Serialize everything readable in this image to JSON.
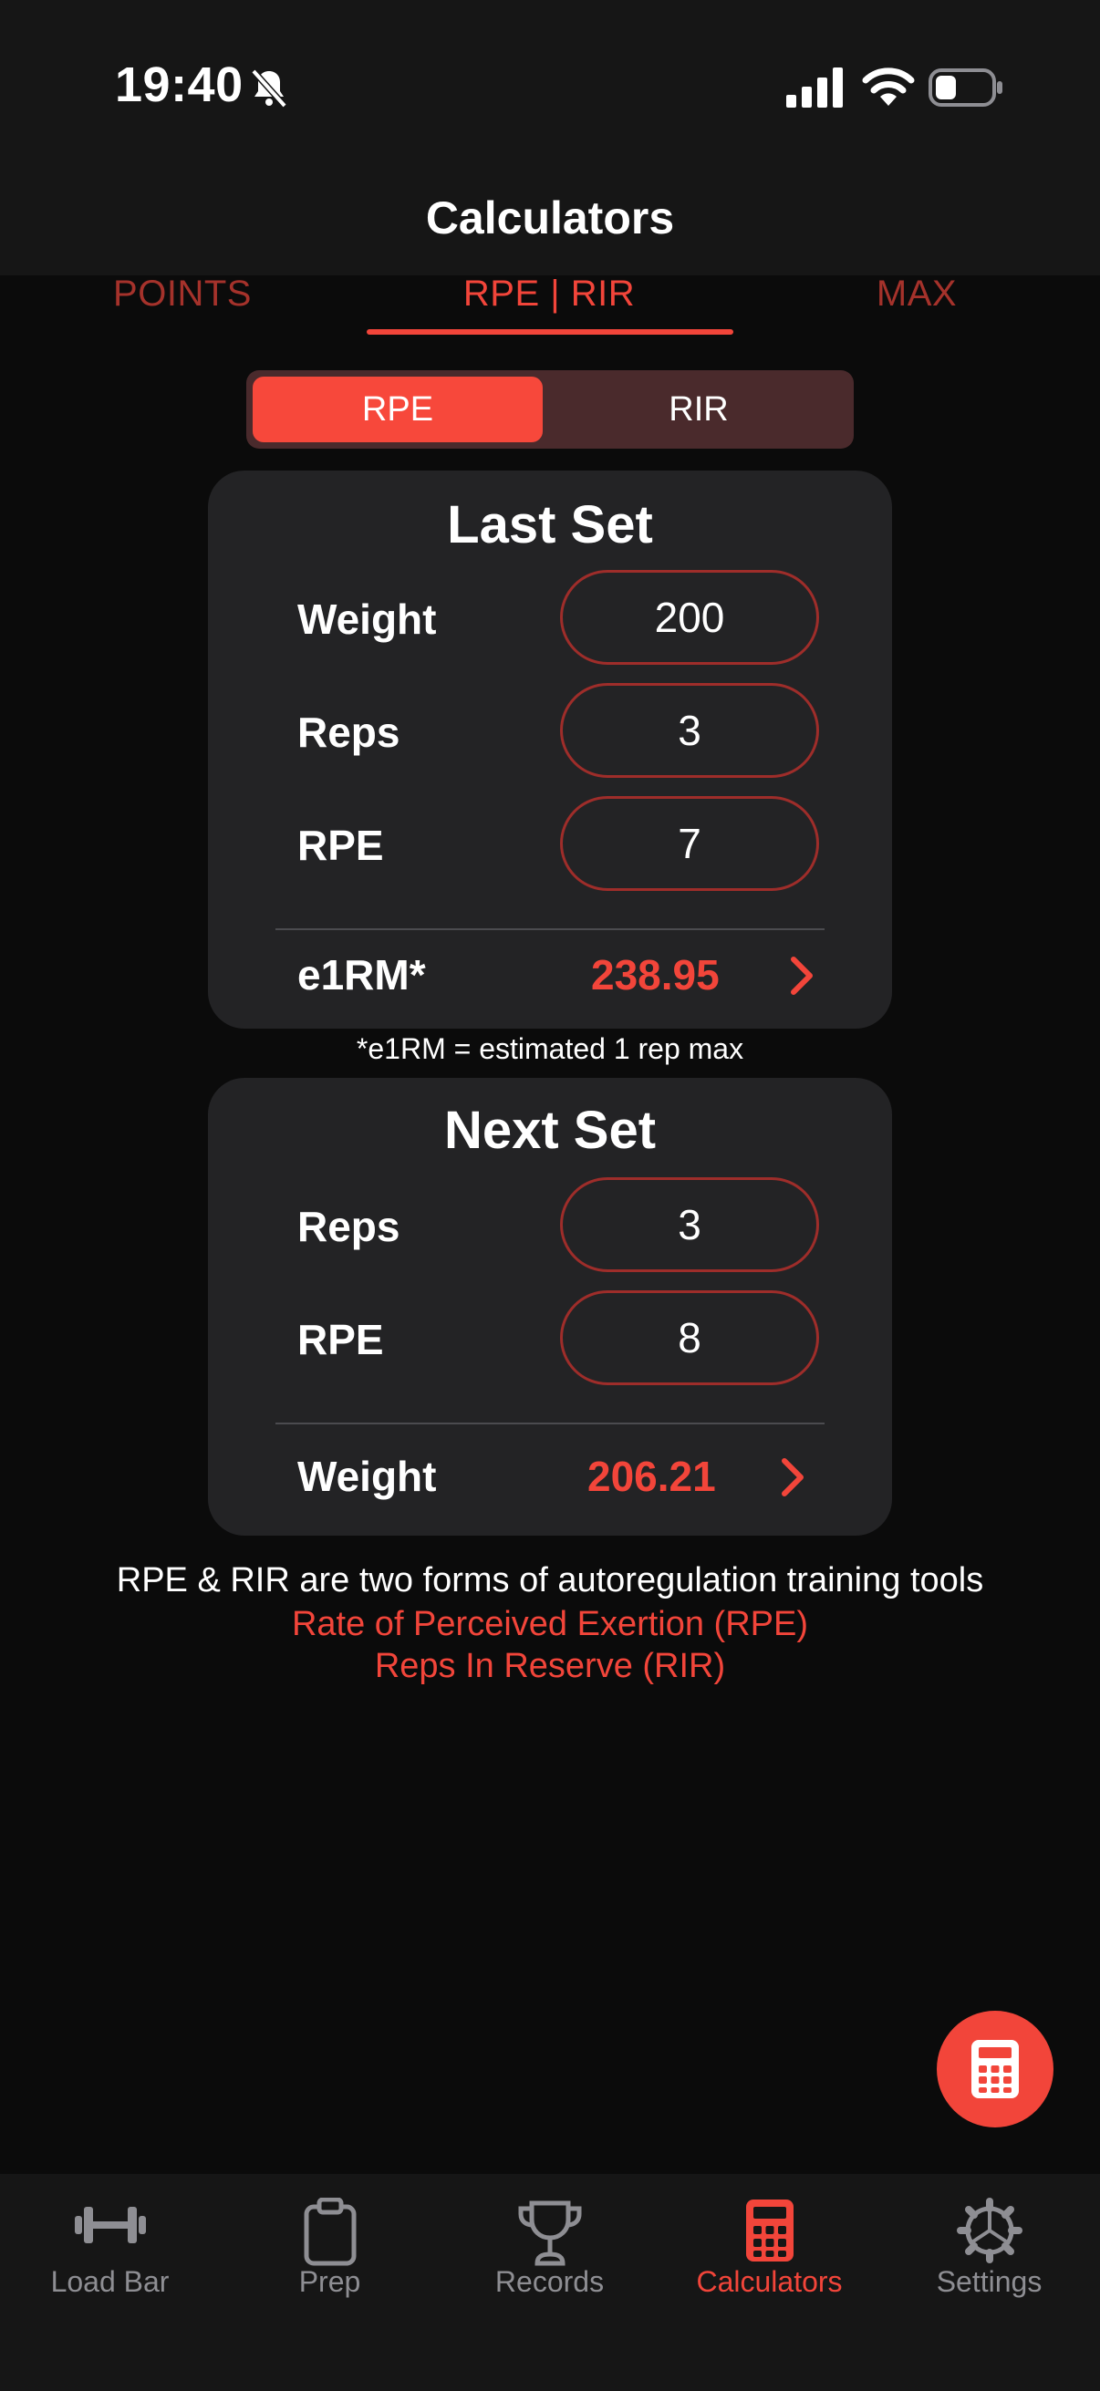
{
  "status_bar": {
    "time": "19:40"
  },
  "header": {
    "title": "Calculators"
  },
  "tabs": [
    {
      "label": "POINTS"
    },
    {
      "label": "RPE | RIR"
    },
    {
      "label": "MAX"
    }
  ],
  "segmented": {
    "rpe": "RPE",
    "rir": "RIR",
    "selected": "RPE"
  },
  "last_set": {
    "title": "Last Set",
    "weight_label": "Weight",
    "weight_value": "200",
    "reps_label": "Reps",
    "reps_value": "3",
    "rpe_label": "RPE",
    "rpe_value": "7",
    "result_label": "e1RM*",
    "result_value": "238.95"
  },
  "footnote": "*e1RM = estimated 1 rep max",
  "next_set": {
    "title": "Next Set",
    "reps_label": "Reps",
    "reps_value": "3",
    "rpe_label": "RPE",
    "rpe_value": "8",
    "result_label": "Weight",
    "result_value": "206.21"
  },
  "info": {
    "line": "RPE & RIR are two forms of autoregulation training tools",
    "rpe_link": "Rate of Perceived Exertion (RPE)",
    "rir_link": "Reps In Reserve (RIR)"
  },
  "bottom_nav": [
    {
      "label": "Load Bar",
      "icon": "dumbbell-icon"
    },
    {
      "label": "Prep",
      "icon": "clipboard-icon"
    },
    {
      "label": "Records",
      "icon": "trophy-icon"
    },
    {
      "label": "Calculators",
      "icon": "calculator-icon",
      "active": true
    },
    {
      "label": "Settings",
      "icon": "gear-icon"
    }
  ],
  "colors": {
    "accent": "#f2453a",
    "background": "#0b0b0b",
    "card": "#232325"
  }
}
